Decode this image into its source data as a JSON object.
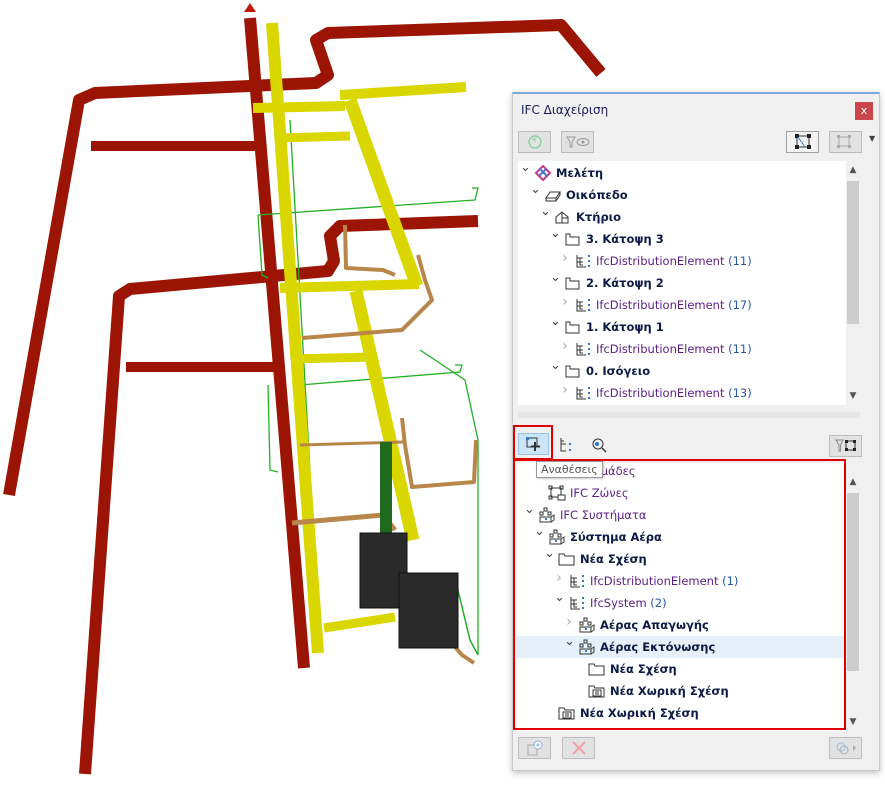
{
  "colors": {
    "supply_duct": "#9c1404",
    "exhaust_duct": "#d9d600",
    "pipe": "#b8864a",
    "wire": "#22b022",
    "equipment": "#2a2a2a",
    "accent_red": "#e00000",
    "selected_row": "#e6f0fa"
  },
  "panel": {
    "title": "IFC Διαχείριση",
    "close_label": "x",
    "top_toolbar": [
      {
        "icon": "refresh-icon",
        "disabled": true
      },
      {
        "icon": "filter-eye-icon",
        "disabled": true
      },
      {
        "icon": "select-elements-icon",
        "disabled": false
      },
      {
        "icon": "spatial-link-icon",
        "disabled": true
      }
    ],
    "top_tree": [
      {
        "label": "Μελέτη",
        "level": 0,
        "expand": "down",
        "icon": "project-icon",
        "style": "bold"
      },
      {
        "label": "Οικόπεδο",
        "level": 1,
        "expand": "down",
        "icon": "site-icon",
        "style": "bold"
      },
      {
        "label": "Κτήριο",
        "level": 2,
        "expand": "down",
        "icon": "building-icon",
        "style": "bold"
      },
      {
        "label": "3. Κάτοψη 3",
        "level": 3,
        "expand": "down",
        "icon": "storey-icon",
        "style": "bold"
      },
      {
        "label": "IfcDistributionElement",
        "count": "(11)",
        "level": 4,
        "expand": "right",
        "icon": "ifc-type-icon",
        "style": "ifc"
      },
      {
        "label": "2. Κάτοψη 2",
        "level": 3,
        "expand": "down",
        "icon": "storey-icon",
        "style": "bold"
      },
      {
        "label": "IfcDistributionElement",
        "count": "(17)",
        "level": 4,
        "expand": "right",
        "icon": "ifc-type-icon",
        "style": "ifc"
      },
      {
        "label": "1. Κάτοψη 1",
        "level": 3,
        "expand": "down",
        "icon": "storey-icon",
        "style": "bold"
      },
      {
        "label": "IfcDistributionElement",
        "count": "(11)",
        "level": 4,
        "expand": "right",
        "icon": "ifc-type-icon",
        "style": "ifc"
      },
      {
        "label": "0. Ισόγειο",
        "level": 3,
        "expand": "down",
        "icon": "storey-icon",
        "style": "bold"
      },
      {
        "label": "IfcDistributionElement",
        "count": "(13)",
        "level": 4,
        "expand": "right",
        "icon": "ifc-type-icon",
        "style": "ifc"
      }
    ],
    "bottom_toolbar": [
      {
        "icon": "assignments-icon",
        "active": true
      },
      {
        "icon": "tree-list-icon"
      },
      {
        "icon": "find-icon"
      },
      {
        "icon": "filter-selection-icon"
      }
    ],
    "tooltip": "Αναθέσεις",
    "bottom_tree": [
      {
        "label": "IFC Ομάδες",
        "level": 1,
        "expand": "none",
        "icon": "group-icon",
        "style": "ifc"
      },
      {
        "label": "IFC Ζώνες",
        "level": 1,
        "expand": "none",
        "icon": "zone-icon",
        "style": "ifc"
      },
      {
        "label": "IFC Συστήματα",
        "level": 0,
        "expand": "down",
        "icon": "system-icon",
        "style": "ifc"
      },
      {
        "label": "Σύστημα Αέρα",
        "level": 1,
        "expand": "down",
        "icon": "system-icon",
        "style": "bold"
      },
      {
        "label": "Νέα Σχέση",
        "level": 2,
        "expand": "down",
        "icon": "folder-icon",
        "style": "bold"
      },
      {
        "label": "IfcDistributionElement",
        "count": "(1)",
        "level": 3,
        "expand": "right",
        "icon": "ifc-type-icon",
        "style": "ifc"
      },
      {
        "label": "IfcSystem",
        "count": "(2)",
        "level": 3,
        "expand": "down",
        "icon": "ifc-type-icon",
        "style": "ifc"
      },
      {
        "label": "Αέρας Απαγωγής",
        "level": 4,
        "expand": "right",
        "icon": "system-icon",
        "style": "bold"
      },
      {
        "label": "Αέρας Εκτόνωσης",
        "level": 4,
        "expand": "down",
        "icon": "system-icon",
        "style": "bold",
        "selected": true
      },
      {
        "label": "Νέα Σχέση",
        "level": 5,
        "expand": "none",
        "icon": "folder-icon",
        "style": "bold"
      },
      {
        "label": "Νέα Χωρική Σχέση",
        "level": 5,
        "expand": "none",
        "icon": "spatial-relation-icon",
        "style": "bold"
      },
      {
        "label": "Νέα Χωρική Σχέση",
        "level": 2,
        "expand": "none",
        "icon": "spatial-relation-icon",
        "style": "bold"
      }
    ],
    "footer": [
      {
        "icon": "new-relation-icon"
      },
      {
        "icon": "delete-icon"
      },
      {
        "icon": "link-menu-icon"
      }
    ]
  }
}
